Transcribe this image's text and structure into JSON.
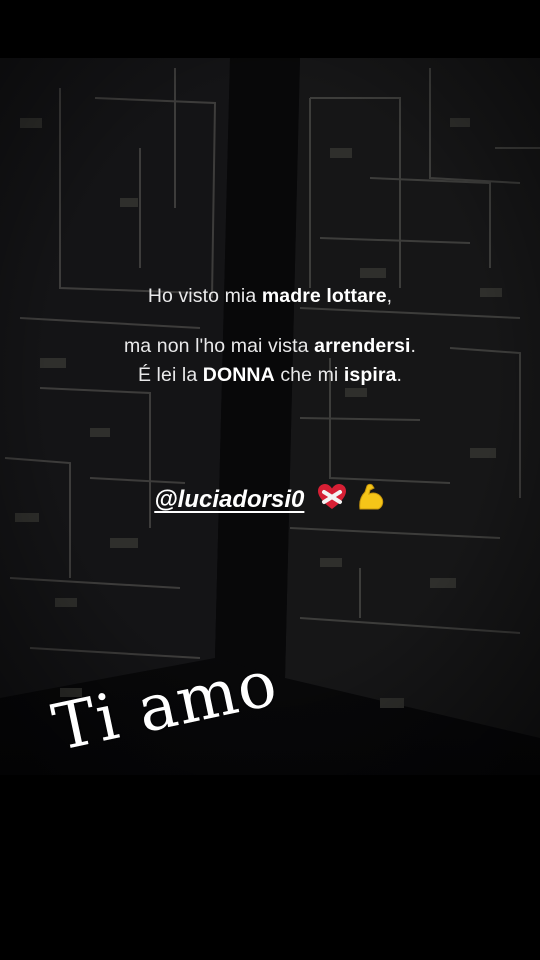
{
  "story": {
    "quote": {
      "line1": {
        "pre": "Ho visto mia ",
        "bold": "madre lottare",
        "post": ","
      },
      "line2": {
        "pre": "ma non l'ho mai vista ",
        "bold": "arrendersi",
        "post": "."
      },
      "line3": {
        "pre": "É lei la ",
        "bold1": "DONNA",
        "mid": " che mi ",
        "bold2": "ispira",
        "post": "."
      }
    },
    "mention": "@luciadorsi0",
    "emojis": [
      "heart-bandage-icon",
      "flexed-biceps-icon"
    ],
    "caption": "Ti amo"
  },
  "colors": {
    "background": "#000000",
    "photo": "#0d0d0e",
    "text": "#e9e9ea",
    "emoji_yellow": "#f5c518",
    "heart_red": "#d61f34"
  }
}
